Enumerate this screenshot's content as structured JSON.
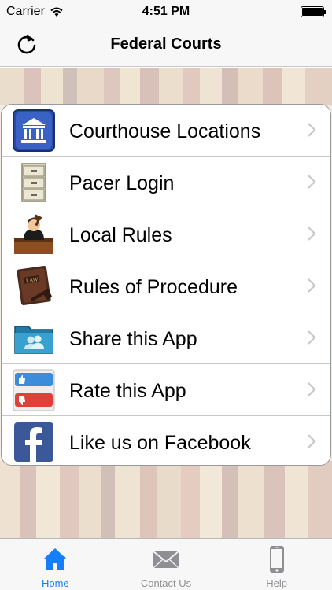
{
  "status_bar": {
    "carrier": "Carrier",
    "time": "4:51 PM",
    "battery_level": 1.0
  },
  "nav": {
    "title": "Federal Courts",
    "refresh_icon": "refresh-icon"
  },
  "menu": {
    "items": [
      {
        "label": "Courthouse Locations",
        "icon": "courthouse-icon"
      },
      {
        "label": "Pacer Login",
        "icon": "file-cabinet-icon"
      },
      {
        "label": "Local Rules",
        "icon": "judge-icon"
      },
      {
        "label": "Rules of Procedure",
        "icon": "law-book-icon"
      },
      {
        "label": "Share this App",
        "icon": "share-folder-icon"
      },
      {
        "label": "Rate this App",
        "icon": "like-unlike-icon"
      },
      {
        "label": "Like us on Facebook",
        "icon": "facebook-icon"
      }
    ]
  },
  "tabs": [
    {
      "label": "Home",
      "icon": "home-icon",
      "active": true
    },
    {
      "label": "Contact Us",
      "icon": "envelope-icon",
      "active": false
    },
    {
      "label": "Help",
      "icon": "phone-icon",
      "active": false
    }
  ],
  "colors": {
    "accent": "#157efb",
    "inactive_tab": "#8e8e93",
    "divider": "#c8c7cc"
  }
}
